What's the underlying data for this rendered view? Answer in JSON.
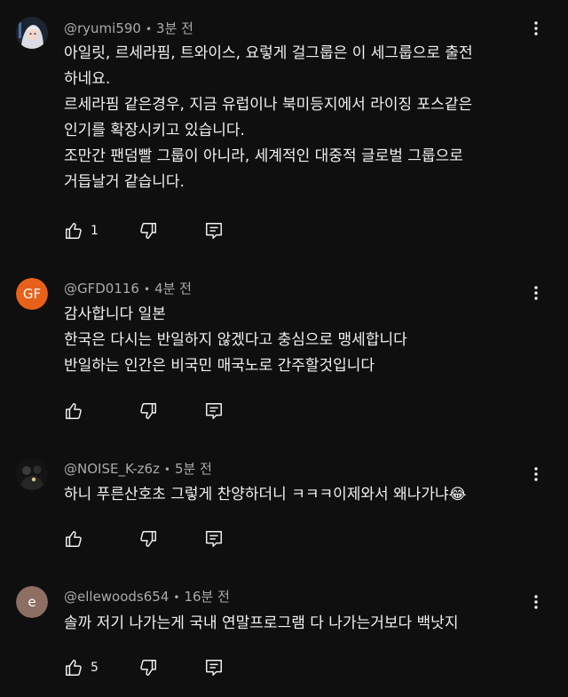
{
  "comments": [
    {
      "handle": "@ryumi590",
      "time": "3분 전",
      "text": "아일릿, 르세라핌, 트와이스, 요렇게 걸그룹은 이 세그룹으로 출전\n하네요.\n르세라핌 같은경우, 지금 유럽이나 북미등지에서 라이징 포스같은\n인기를 확장시키고 있습니다.\n조만간 팬덤빨 그룹이 아니라, 세계적인 대중적 글로벌 그룹으로\n거듭날거 같습니다.",
      "likes": "1",
      "avatar_icon": "anime-avatar-icon"
    },
    {
      "handle": "@GFD0116",
      "time": "4분 전",
      "text": "감사합니다 일본\n한국은 다시는 반일하지 않겠다고 충심으로 맹세합니다\n반일하는 인간은 비국민 매국노로 간주할것입니다",
      "likes": "",
      "avatar_initials": "GF",
      "avatar_color": "#e8611a"
    },
    {
      "handle": "@NOISE_K-z6z",
      "time": "5분 전",
      "text": "하니 푸른산호초 그렇게 찬양하더니 ㅋㅋㅋ이제와서 왜나가냐😂",
      "likes": "",
      "avatar_icon": "dark-photo-avatar-icon"
    },
    {
      "handle": "@ellewoods654",
      "time": "16분 전",
      "text": "솔까 저기 나가는게 국내 연말프로그램 다 나가는거보다 백낫지",
      "likes": "5",
      "avatar_initials": "e",
      "avatar_color": "#8d6e63"
    }
  ],
  "separator": "•",
  "colors": {
    "background": "#0f0f0f",
    "text": "#f1f1f1",
    "secondary_text": "#aaaaaa"
  }
}
